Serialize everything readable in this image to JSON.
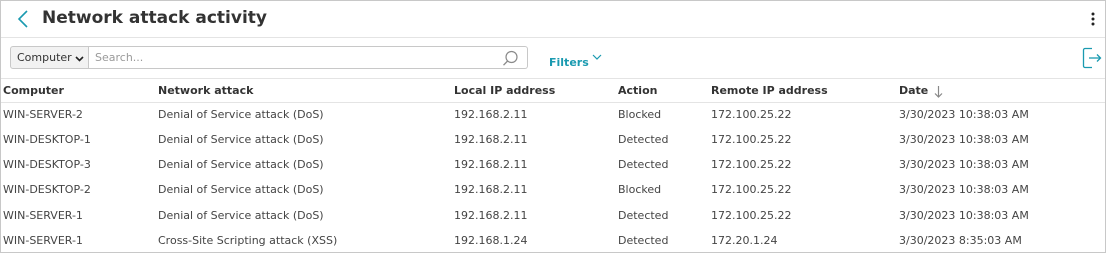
{
  "header": {
    "title": "Network attack activity"
  },
  "toolbar": {
    "select_value": "Computer",
    "search_placeholder": "Search...",
    "filters_label": "Filters"
  },
  "table": {
    "columns": [
      "Computer",
      "Network attack",
      "Local IP address",
      "Action",
      "Remote IP address",
      "Date"
    ],
    "sort_column": "Date",
    "sort_direction": "descending",
    "rows": [
      [
        "WIN-SERVER-2",
        "Denial of Service attack (DoS)",
        "192.168.2.11",
        "Blocked",
        "172.100.25.22",
        "3/30/2023 10:38:03 AM"
      ],
      [
        "WIN-DESKTOP-1",
        "Denial of Service attack (DoS)",
        "192.168.2.11",
        "Detected",
        "172.100.25.22",
        "3/30/2023 10:38:03 AM"
      ],
      [
        "WIN-DESKTOP-3",
        "Denial of Service attack (DoS)",
        "192.168.2.11",
        "Detected",
        "172.100.25.22",
        "3/30/2023 10:38:03 AM"
      ],
      [
        "WIN-DESKTOP-2",
        "Denial of Service attack (DoS)",
        "192.168.2.11",
        "Blocked",
        "172.100.25.22",
        "3/30/2023 10:38:03 AM"
      ],
      [
        "WIN-SERVER-1",
        "Denial of Service attack (DoS)",
        "192.168.2.11",
        "Detected",
        "172.100.25.22",
        "3/30/2023 10:38:03 AM"
      ],
      [
        "WIN-SERVER-1",
        "Cross-Site Scripting attack (XSS)",
        "192.168.1.24",
        "Detected",
        "172.20.1.24",
        "3/30/2023 8:35:03 AM"
      ]
    ]
  },
  "icons": {
    "back": "chevron-left-icon",
    "menu": "kebab-menu-icon",
    "search": "search-icon",
    "filters": "chevron-down-icon",
    "export": "export-icon",
    "sort": "arrow-down-icon"
  },
  "colors": {
    "accent": "#1a9ab0",
    "text": "#333333",
    "border": "#c8c8c8"
  }
}
